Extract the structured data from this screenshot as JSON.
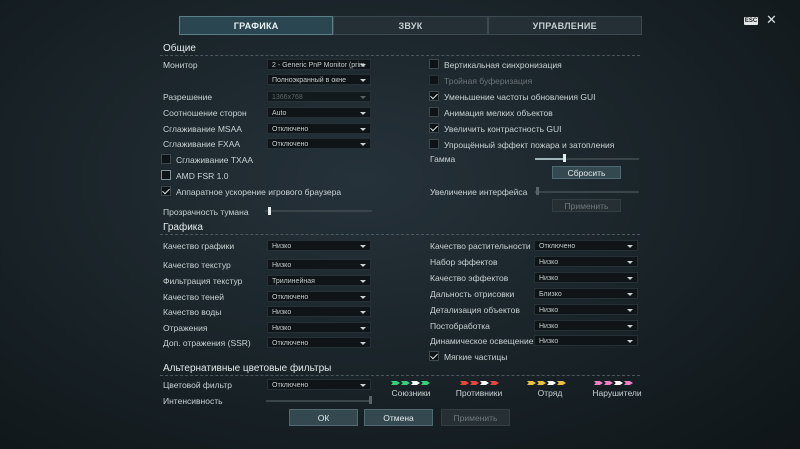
{
  "tabs": [
    {
      "label": "ГРАФИКА",
      "active": true
    },
    {
      "label": "ЗВУК",
      "active": false
    },
    {
      "label": "УПРАВЛЕНИЕ",
      "active": false
    }
  ],
  "esc_label": "ESC",
  "close_glyph": "✕",
  "general": {
    "title": "Общие",
    "monitor_label": "Монитор",
    "monitor_value": "2 - Generic PnP Monitor (prim",
    "mode_value": "Полноэкранный в окне",
    "resolution_label": "Разрешение",
    "resolution_value": "1366x768",
    "aspect_label": "Соотношение сторон",
    "aspect_value": "Auto",
    "msaa_label": "Сглаживание MSAA",
    "msaa_value": "Отключено",
    "fxaa_label": "Сглаживание FXAA",
    "fxaa_value": "Отключено",
    "txaa_label": "Сглаживание TXAA",
    "txaa_checked": false,
    "fsr_label": "AMD FSR 1.0",
    "fsr_checked": false,
    "browser_label": "Аппаратное ускорение игрового браузера",
    "browser_checked": true,
    "fog_label": "Прозрачность тумана",
    "fog_level": 0.03,
    "vsync_label": "Вертикальная синхронизация",
    "vsync_checked": false,
    "triple_label": "Тройная буферизация",
    "triple_checked": false,
    "gui_rate_label": "Уменьшение частоты обновления GUI",
    "gui_rate_checked": true,
    "anim_label": "Анимация мелких объектов",
    "anim_checked": false,
    "contrast_label": "Увеличить контрастность GUI",
    "contrast_checked": true,
    "fire_label": "Упрощённый эффект пожара и затопления",
    "fire_checked": false,
    "gamma_label": "Гамма",
    "gamma_level": 0.28,
    "reset_label": "Сбросить",
    "ui_scale_label": "Увеличение интерфейса",
    "ui_scale_level": 0.0,
    "apply_scale_label": "Применить"
  },
  "graphics": {
    "title": "Графика",
    "left": [
      {
        "label": "Качество графики",
        "value": "Низко"
      },
      {
        "label": "Качество текстур",
        "value": "Низко"
      },
      {
        "label": "Фильтрация текстур",
        "value": "Трилинейная"
      },
      {
        "label": "Качество теней",
        "value": "Отключено"
      },
      {
        "label": "Качество воды",
        "value": "Низко"
      },
      {
        "label": "Отражения",
        "value": "Низко"
      },
      {
        "label": "Доп. отражения (SSR)",
        "value": "Отключено"
      }
    ],
    "right": [
      {
        "label": "Качество растительности",
        "value": "Отключено"
      },
      {
        "label": "Набор эффектов",
        "value": "Низко"
      },
      {
        "label": "Качество эффектов",
        "value": "Низко"
      },
      {
        "label": "Дальность отрисовки",
        "value": "Близко"
      },
      {
        "label": "Детализация объектов",
        "value": "Низко"
      },
      {
        "label": "Постобработка",
        "value": "Низко"
      },
      {
        "label": "Динамическое освещение",
        "value": "Низко"
      }
    ],
    "soft_particles_label": "Мягкие частицы",
    "soft_particles_checked": true
  },
  "filters": {
    "title": "Альтернативные цветовые фильтры",
    "filter_label": "Цветовой фильтр",
    "filter_value": "Отключено",
    "intensity_label": "Интенсивность",
    "intensity_level": 1.0,
    "groups": [
      {
        "label": "Союзники",
        "color": "#37d07a"
      },
      {
        "label": "Противники",
        "color": "#e8463c"
      },
      {
        "label": "Отряд",
        "color": "#e8c23a"
      },
      {
        "label": "Нарушители",
        "color": "#ef7fc0"
      }
    ]
  },
  "footer": {
    "ok_label": "ОК",
    "cancel_label": "Отмена",
    "apply_label": "Применить"
  },
  "colors": {
    "accent": "#2a4650",
    "background": "#182227"
  }
}
